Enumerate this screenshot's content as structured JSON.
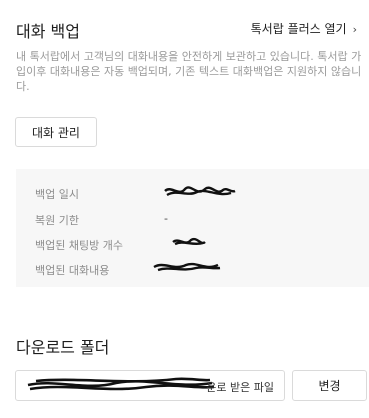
{
  "header": {
    "title": "대화 백업",
    "link_label": "톡서랍 플러스 열기",
    "link_chevron": "›"
  },
  "description": "내 톡서랍에서 고객님의 대화내용을 안전하게 보관하고 있습니다. 톡서랍 가입이후 대화내용은 자동 백업되며, 기존 텍스트 대화백업은 지원하지 않습니다.",
  "manage_button": "대화 관리",
  "info": {
    "rows": [
      {
        "label": "백업 일시",
        "value": ""
      },
      {
        "label": "복원 기한",
        "value": "-"
      },
      {
        "label": "백업된 채팅방 개수",
        "value": ""
      },
      {
        "label": "백업된 대화내용",
        "value": ""
      }
    ]
  },
  "download": {
    "title": "다운로드 폴더",
    "path_suffix": "운로 받은 파일",
    "change_button": "변경"
  },
  "icons": [
    "chevron-right-icon"
  ]
}
